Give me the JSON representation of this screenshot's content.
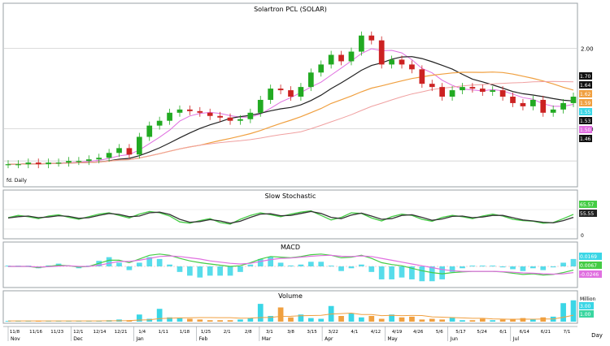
{
  "app": {
    "price_panel_title": "Solartron PCL (SOLAR)",
    "price_panel_tag": "fd. Daily",
    "stochastic_title": "Slow Stochastic",
    "macd_title": "MACD",
    "volume_title": "Volume",
    "volume_unit": "Million",
    "x_axis_unit": "Day"
  },
  "colors": {
    "up_candle": "#22aa22",
    "down_candle": "#cc2222",
    "ma_pink": "#e070e0",
    "ma_black": "#222222",
    "ma_orange": "#f0a040",
    "ma_salmon": "#f0a0a0",
    "stoch_k": "#44cc44",
    "stoch_d": "#333333",
    "macd_line": "#44cc44",
    "signal_line": "#e070e0",
    "hist": "#3ad6e6",
    "volume_up": "#3ad6e6",
    "volume_down": "#f0a040"
  },
  "chart_data": [
    {
      "type": "candlestick",
      "title": "Solartron PCL (SOLAR)",
      "y_ticks": [
        "2.00",
        "1.50"
      ],
      "last_value_labels": [
        "1.70",
        "1.64",
        "1.62",
        "1.59",
        "1.55",
        "1.53",
        "1.50",
        "1.46"
      ],
      "x_months": [
        "Nov",
        "Dec",
        "Jan",
        "Feb",
        "Mar",
        "Apr",
        "May",
        "Jun",
        "Jul"
      ],
      "x_days": [
        "11/8",
        "11/16",
        "11/23",
        "12/1",
        "12/14",
        "12/21",
        "1/4",
        "1/11",
        "1/18",
        "1/25",
        "2/1",
        "2/8",
        "3/1",
        "3/8",
        "3/15",
        "3/22",
        "4/1",
        "4/12",
        "4/19",
        "4/26",
        "5/6",
        "5/17",
        "5/24",
        "6/1",
        "6/14",
        "6/21",
        "7/1"
      ],
      "series": [
        {
          "name": "SOLAR",
          "close": [
            1.28,
            1.28,
            1.29,
            1.28,
            1.29,
            1.29,
            1.3,
            1.3,
            1.31,
            1.32,
            1.35,
            1.38,
            1.34,
            1.45,
            1.52,
            1.55,
            1.6,
            1.62,
            1.61,
            1.6,
            1.58,
            1.57,
            1.55,
            1.56,
            1.6,
            1.68,
            1.75,
            1.74,
            1.7,
            1.76,
            1.85,
            1.9,
            1.96,
            1.92,
            1.98,
            2.08,
            2.05,
            1.9,
            1.93,
            1.9,
            1.87,
            1.78,
            1.76,
            1.7,
            1.74,
            1.76,
            1.75,
            1.73,
            1.74,
            1.7,
            1.66,
            1.64,
            1.68,
            1.6,
            1.62,
            1.66,
            1.7
          ]
        }
      ]
    },
    {
      "type": "line",
      "title": "Slow Stochastic",
      "last_value_labels": [
        "65.57",
        "55.55"
      ],
      "y_ticks": [
        "0"
      ],
      "series": [
        {
          "name": "%K",
          "values": [
            55,
            62,
            58,
            52,
            60,
            64,
            56,
            50,
            58,
            66,
            70,
            62,
            54,
            66,
            74,
            70,
            60,
            42,
            38,
            46,
            52,
            40,
            35,
            50,
            62,
            70,
            64,
            58,
            66,
            72,
            76,
            62,
            48,
            56,
            70,
            68,
            54,
            45,
            58,
            66,
            62,
            50,
            44,
            56,
            62,
            58,
            52,
            60,
            66,
            60,
            50,
            46,
            44,
            38,
            40,
            52,
            65
          ]
        },
        {
          "name": "%D",
          "values": [
            54,
            58,
            60,
            55,
            57,
            61,
            59,
            53,
            55,
            62,
            68,
            65,
            58,
            60,
            70,
            72,
            65,
            50,
            41,
            43,
            49,
            45,
            38,
            44,
            56,
            66,
            67,
            61,
            62,
            68,
            74,
            68,
            56,
            52,
            63,
            69,
            60,
            50,
            52,
            62,
            64,
            56,
            47,
            51,
            59,
            60,
            55,
            57,
            62,
            62,
            55,
            48,
            45,
            41,
            39,
            46,
            56
          ]
        }
      ]
    },
    {
      "type": "line",
      "title": "MACD",
      "last_value_labels": [
        "0.0169",
        "0.0067",
        "-0.0246"
      ],
      "series": [
        {
          "name": "MACD",
          "values": [
            0.0,
            0.0,
            0.0,
            -0.004,
            0.0,
            0.004,
            0.002,
            -0.002,
            0.0,
            0.01,
            0.02,
            0.02,
            0.012,
            0.024,
            0.036,
            0.04,
            0.036,
            0.026,
            0.018,
            0.012,
            0.008,
            0.004,
            0.0,
            0.002,
            0.012,
            0.024,
            0.032,
            0.03,
            0.028,
            0.032,
            0.038,
            0.04,
            0.036,
            0.028,
            0.03,
            0.036,
            0.026,
            0.012,
            0.006,
            0.002,
            -0.006,
            -0.014,
            -0.02,
            -0.024,
            -0.02,
            -0.018,
            -0.016,
            -0.016,
            -0.016,
            -0.018,
            -0.022,
            -0.026,
            -0.024,
            -0.028,
            -0.026,
            -0.02,
            -0.012
          ]
        },
        {
          "name": "Signal",
          "values": [
            0.0,
            0.0,
            0.0,
            -0.002,
            -0.001,
            0.001,
            0.002,
            0.0,
            0.0,
            0.004,
            0.01,
            0.016,
            0.016,
            0.02,
            0.026,
            0.032,
            0.034,
            0.032,
            0.028,
            0.024,
            0.018,
            0.014,
            0.01,
            0.008,
            0.01,
            0.016,
            0.022,
            0.026,
            0.027,
            0.03,
            0.033,
            0.035,
            0.036,
            0.033,
            0.032,
            0.034,
            0.032,
            0.026,
            0.02,
            0.014,
            0.008,
            0.002,
            -0.004,
            -0.01,
            -0.014,
            -0.016,
            -0.016,
            -0.016,
            -0.016,
            -0.017,
            -0.019,
            -0.021,
            -0.022,
            -0.024,
            -0.025,
            -0.024,
            -0.02
          ]
        }
      ]
    },
    {
      "type": "bar",
      "title": "Volume",
      "unit": "Million",
      "last_value_labels": [
        "3.00",
        "1.00"
      ],
      "values": [
        0.1,
        0.1,
        0.1,
        0.1,
        0.1,
        0.1,
        0.1,
        0.1,
        0.1,
        0.1,
        0.2,
        0.3,
        0.2,
        1.0,
        0.4,
        1.8,
        0.6,
        0.5,
        0.4,
        0.3,
        0.2,
        0.2,
        0.2,
        0.3,
        0.5,
        2.5,
        0.8,
        2.0,
        0.6,
        1.0,
        0.5,
        0.4,
        2.2,
        0.8,
        1.2,
        0.6,
        0.8,
        0.4,
        1.0,
        0.6,
        0.7,
        0.3,
        0.4,
        0.3,
        0.6,
        0.2,
        0.2,
        0.4,
        0.2,
        0.3,
        0.4,
        0.5,
        0.3,
        0.6,
        0.7,
        2.6,
        3.0
      ]
    }
  ]
}
